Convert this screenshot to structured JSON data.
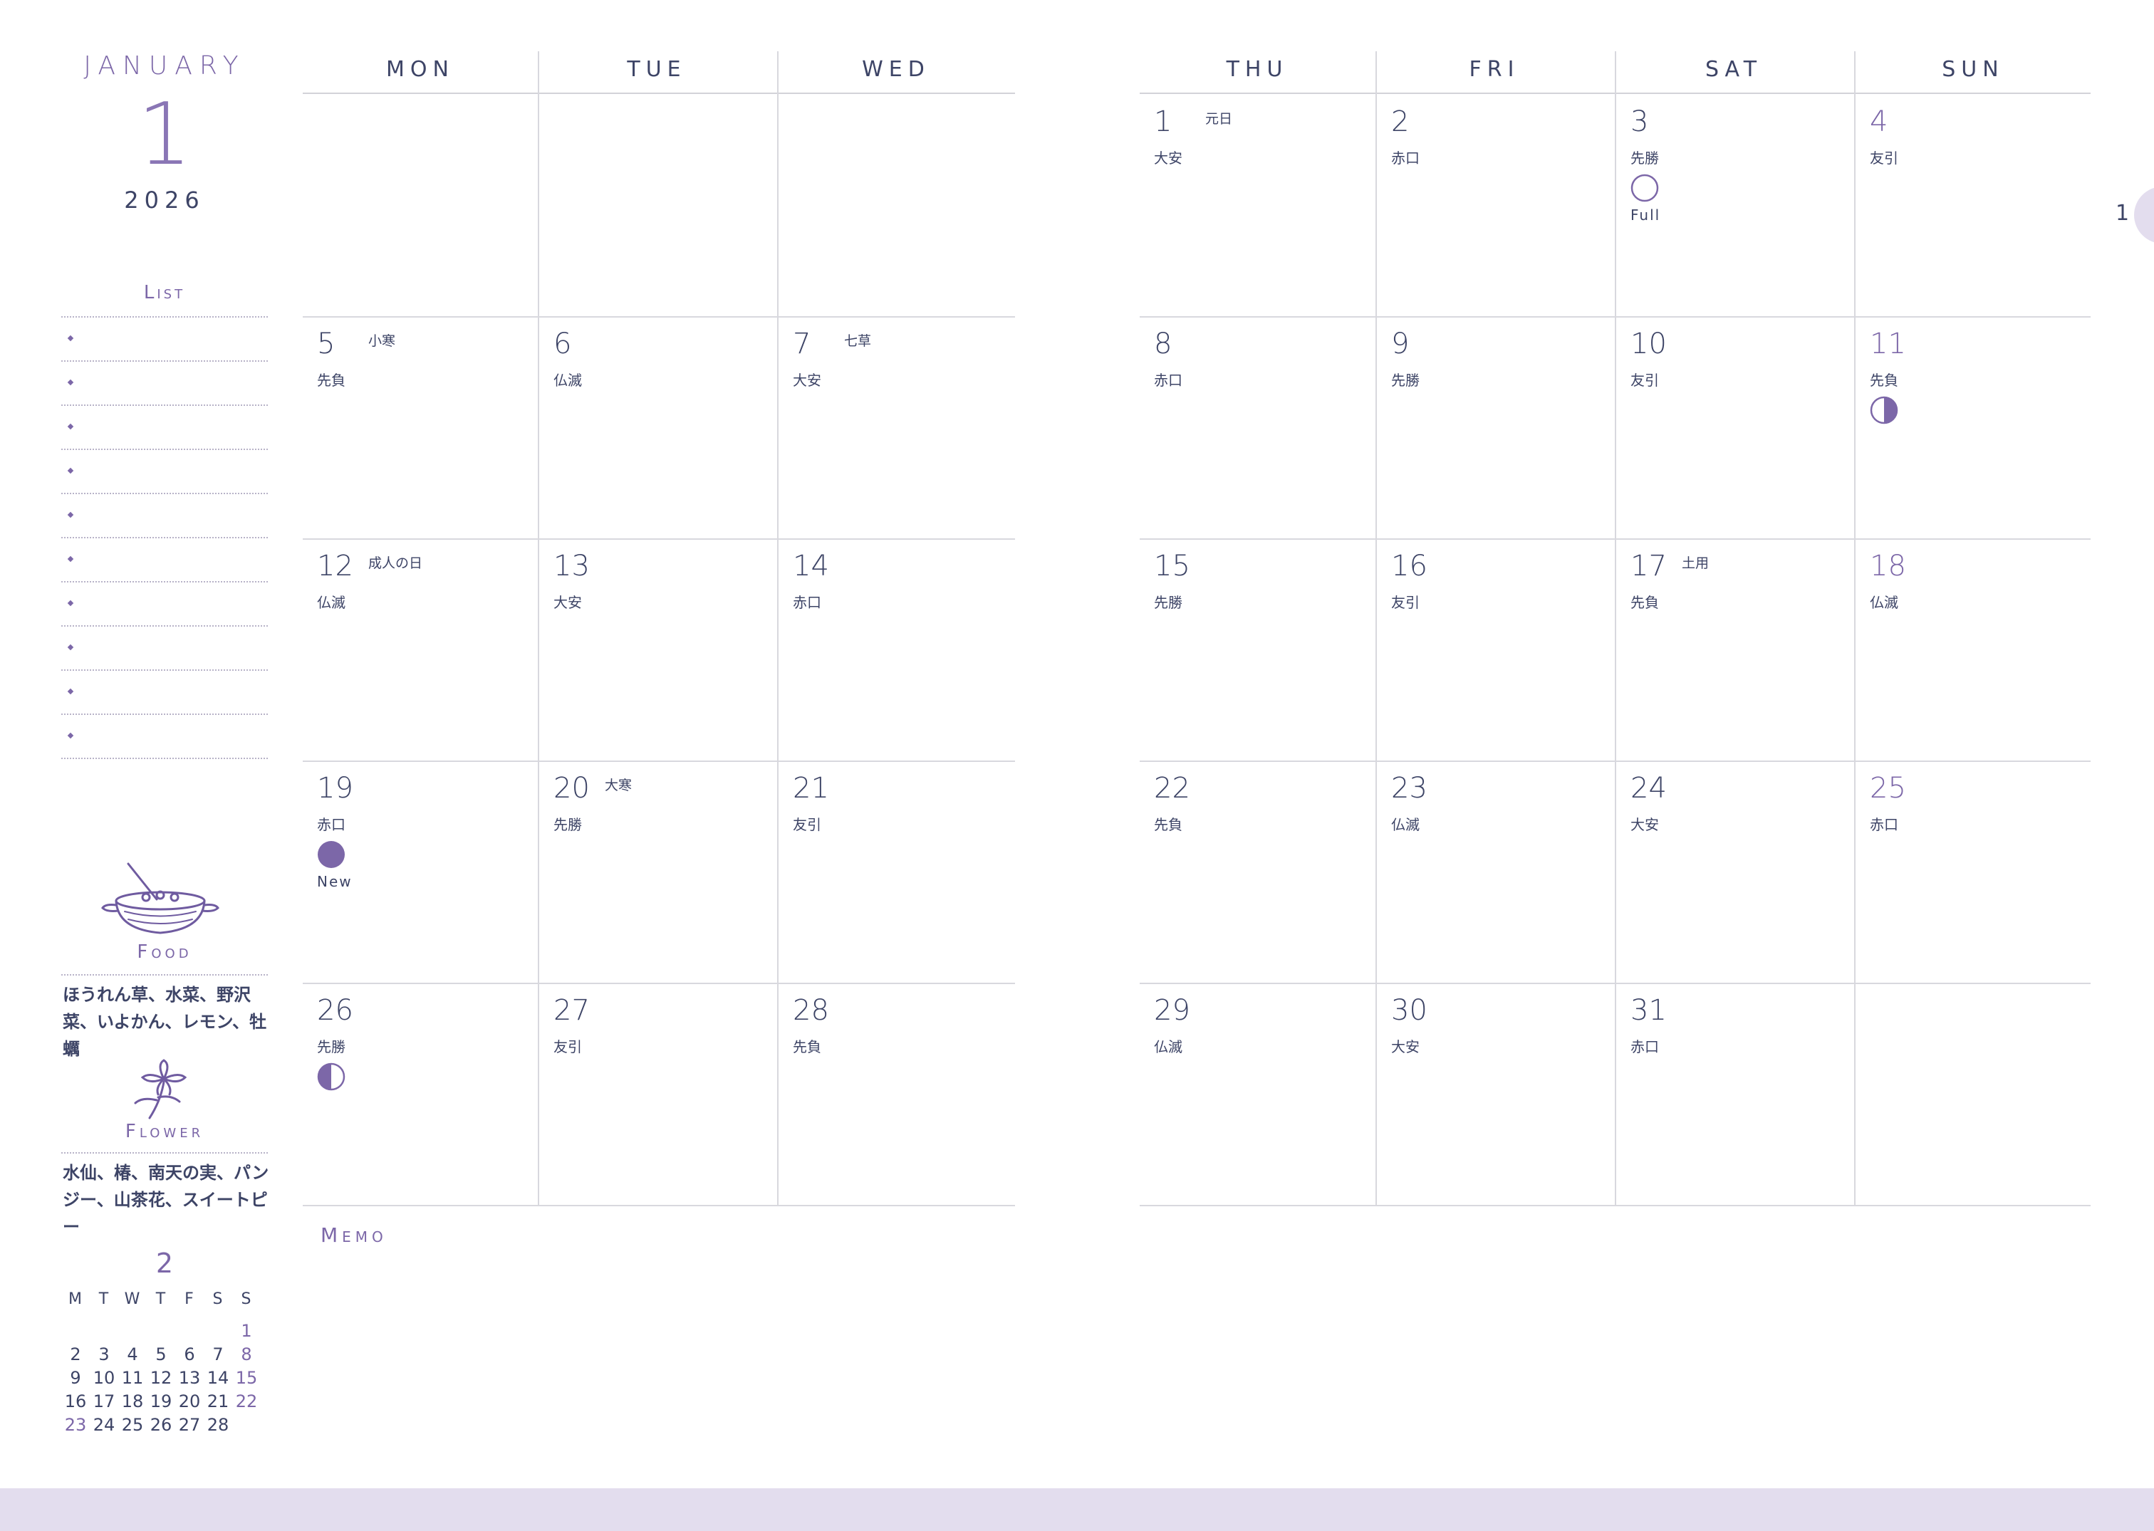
{
  "header": {
    "month_name": "JANUARY",
    "month_number": "1",
    "year": "2026"
  },
  "list": {
    "title": "List",
    "rows": 10
  },
  "food": {
    "title": "Food",
    "text": "ほうれん草、水菜、野沢菜、いよかん、レモン、牡蠣"
  },
  "flower": {
    "title": "Flower",
    "text": "水仙、椿、南天の実、パンジー、山茶花、スイートピー"
  },
  "mini_calendar": {
    "month": "2",
    "weekdays": [
      "M",
      "T",
      "W",
      "T",
      "F",
      "S",
      "S"
    ],
    "weeks": [
      [
        "",
        "",
        "",
        "",
        "",
        "",
        "1"
      ],
      [
        "2",
        "3",
        "4",
        "5",
        "6",
        "7",
        "8"
      ],
      [
        "9",
        "10",
        "11",
        "12",
        "13",
        "14",
        "15"
      ],
      [
        "16",
        "17",
        "18",
        "19",
        "20",
        "21",
        "22"
      ],
      [
        "23",
        "24",
        "25",
        "26",
        "27",
        "28",
        ""
      ]
    ]
  },
  "weekdays": [
    "MON",
    "TUE",
    "WED",
    "THU",
    "FRI",
    "SAT",
    "SUN"
  ],
  "weeks": [
    [
      null,
      null,
      null,
      {
        "day": "1",
        "rokuyo": "大安",
        "holiday": "元日"
      },
      {
        "day": "2",
        "rokuyo": "赤口"
      },
      {
        "day": "3",
        "rokuyo": "先勝",
        "moon": "full",
        "moon_label": "Full"
      },
      {
        "day": "4",
        "rokuyo": "友引"
      }
    ],
    [
      {
        "day": "5",
        "rokuyo": "先負",
        "holiday": "小寒"
      },
      {
        "day": "6",
        "rokuyo": "仏滅"
      },
      {
        "day": "7",
        "rokuyo": "大安",
        "holiday": "七草"
      },
      {
        "day": "8",
        "rokuyo": "赤口"
      },
      {
        "day": "9",
        "rokuyo": "先勝"
      },
      {
        "day": "10",
        "rokuyo": "友引"
      },
      {
        "day": "11",
        "rokuyo": "先負",
        "moon": "first-quarter"
      }
    ],
    [
      {
        "day": "12",
        "rokuyo": "仏滅",
        "holiday": "成人の日"
      },
      {
        "day": "13",
        "rokuyo": "大安"
      },
      {
        "day": "14",
        "rokuyo": "赤口"
      },
      {
        "day": "15",
        "rokuyo": "先勝"
      },
      {
        "day": "16",
        "rokuyo": "友引"
      },
      {
        "day": "17",
        "rokuyo": "先負",
        "holiday": "土用"
      },
      {
        "day": "18",
        "rokuyo": "仏滅"
      }
    ],
    [
      {
        "day": "19",
        "rokuyo": "赤口",
        "moon": "new",
        "moon_label": "New"
      },
      {
        "day": "20",
        "rokuyo": "先勝",
        "holiday": "大寒"
      },
      {
        "day": "21",
        "rokuyo": "友引"
      },
      {
        "day": "22",
        "rokuyo": "先負"
      },
      {
        "day": "23",
        "rokuyo": "仏滅"
      },
      {
        "day": "24",
        "rokuyo": "大安"
      },
      {
        "day": "25",
        "rokuyo": "赤口"
      }
    ],
    [
      {
        "day": "26",
        "rokuyo": "先勝",
        "moon": "last-quarter"
      },
      {
        "day": "27",
        "rokuyo": "友引"
      },
      {
        "day": "28",
        "rokuyo": "先負"
      },
      {
        "day": "29",
        "rokuyo": "仏滅"
      },
      {
        "day": "30",
        "rokuyo": "大安"
      },
      {
        "day": "31",
        "rokuyo": "赤口"
      },
      null
    ]
  ],
  "memo": {
    "title": "Memo"
  },
  "page_tab": {
    "number": "1"
  },
  "colors": {
    "accent": "#7c67a8",
    "text": "#3d4466",
    "band": "#e3ddee"
  }
}
